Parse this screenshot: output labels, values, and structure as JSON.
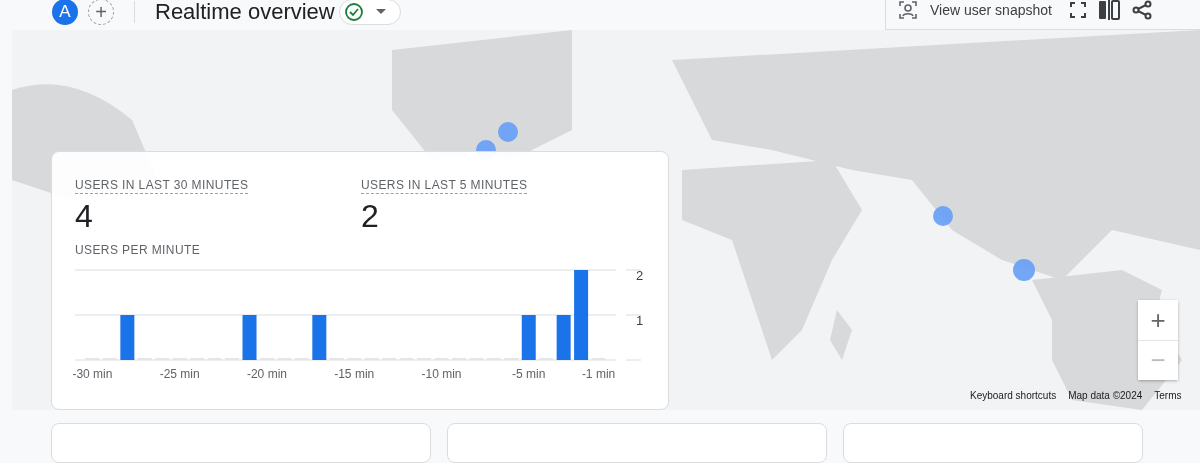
{
  "header": {
    "avatar": "A",
    "add": "+",
    "title": "Realtime overview",
    "verified": true,
    "actions": [
      {
        "kind": "snapshot",
        "label": "View user snapshot"
      },
      {
        "kind": "fullscreen"
      },
      {
        "kind": "compare"
      },
      {
        "kind": "share"
      }
    ]
  },
  "map": {
    "attribution": [
      "Keyboard shortcuts",
      "Map data ©2024",
      "Terms"
    ],
    "zoom_in": "+",
    "zoom_out": "−"
  },
  "summary": {
    "metrics": [
      {
        "label": "USERS IN LAST 30 MINUTES",
        "value": "4"
      },
      {
        "label": "USERS IN LAST 5 MINUTES",
        "value": "2"
      }
    ],
    "chart_title": "USERS PER MINUTE",
    "chart_data": {
      "type": "bar",
      "x": [
        -30,
        -29,
        -28,
        -27,
        -26,
        -25,
        -24,
        -23,
        -22,
        -21,
        -20,
        -19,
        -18,
        -17,
        -16,
        -15,
        -14,
        -13,
        -12,
        -11,
        -10,
        -9,
        -8,
        -7,
        -6,
        -5,
        -4,
        -3,
        -2,
        -1
      ],
      "values": [
        0,
        0,
        1,
        0,
        0,
        0,
        0,
        0,
        0,
        1,
        0,
        0,
        0,
        1,
        0,
        0,
        0,
        0,
        0,
        0,
        0,
        0,
        0,
        0,
        0,
        1,
        0,
        1,
        2,
        0
      ],
      "xticks": [
        {
          "value": -30,
          "label": "-30 min"
        },
        {
          "value": -25,
          "label": "-25 min"
        },
        {
          "value": -20,
          "label": "-20 min"
        },
        {
          "value": -15,
          "label": "-15 min"
        },
        {
          "value": -10,
          "label": "-10 min"
        },
        {
          "value": -5,
          "label": "-5 min"
        },
        {
          "value": -1,
          "label": "-1 min"
        }
      ],
      "yticks": [
        1,
        2
      ],
      "xlim": [
        -31,
        0
      ],
      "ylim": [
        0,
        2
      ]
    }
  }
}
